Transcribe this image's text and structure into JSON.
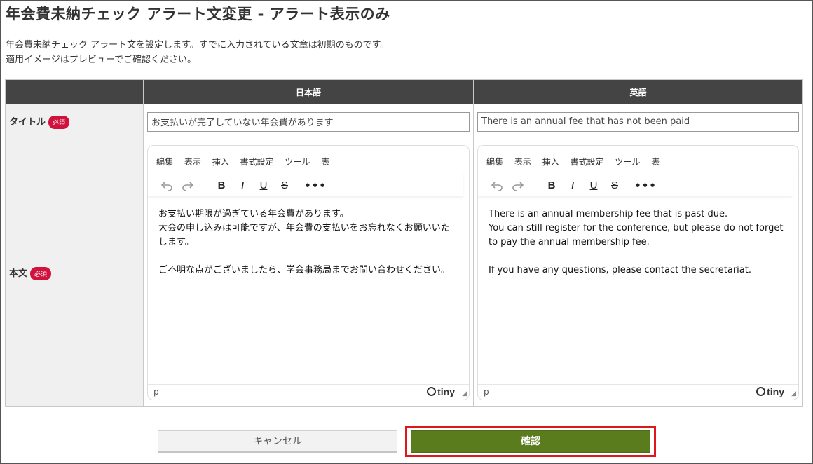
{
  "page": {
    "title": "年会費未納チェック アラート文変更 - アラート表示のみ",
    "description_line1": "年会費未納チェック アラート文を設定します。すでに入力されている文章は初期のものです。",
    "description_line2": "適用イメージはプレビューでご確認ください。"
  },
  "table": {
    "header_blank": "",
    "col_japanese": "日本語",
    "col_english": "英語",
    "required_badge": "必須",
    "title_label": "タイトル",
    "body_label": "本文"
  },
  "title_fields": {
    "japanese_value": "お支払いが完了していない年会費があります",
    "english_value": "There is an annual fee that has not been paid"
  },
  "editor": {
    "menu": [
      "編集",
      "表示",
      "挿入",
      "書式設定",
      "ツール",
      "表"
    ],
    "toolbar": {
      "undo_icon": "undo-icon",
      "redo_icon": "redo-icon",
      "bold": "B",
      "italic": "I",
      "underline": "U",
      "strikethrough": "S",
      "more": "•••"
    },
    "status_path": "p",
    "brand": "tiny"
  },
  "body_japanese": {
    "para1": "お支払い期限が過ぎている年会費があります。\n大会の申し込みは可能ですが、年会費の支払いをお忘れなくお願いいたします。",
    "para2": "ご不明な点がございましたら、学会事務局までお問い合わせください。"
  },
  "body_english": {
    "para1": "There is an annual membership fee that is past due.\nYou can still register for the conference, but please do not forget to pay the annual membership fee.",
    "para2": "If you have any questions, please contact the secretariat."
  },
  "buttons": {
    "cancel": "キャンセル",
    "confirm": "確認"
  },
  "colors": {
    "header_bg": "#444444",
    "badge": "#d0123d",
    "confirm": "#5a7c1d",
    "highlight": "#e0161c"
  }
}
